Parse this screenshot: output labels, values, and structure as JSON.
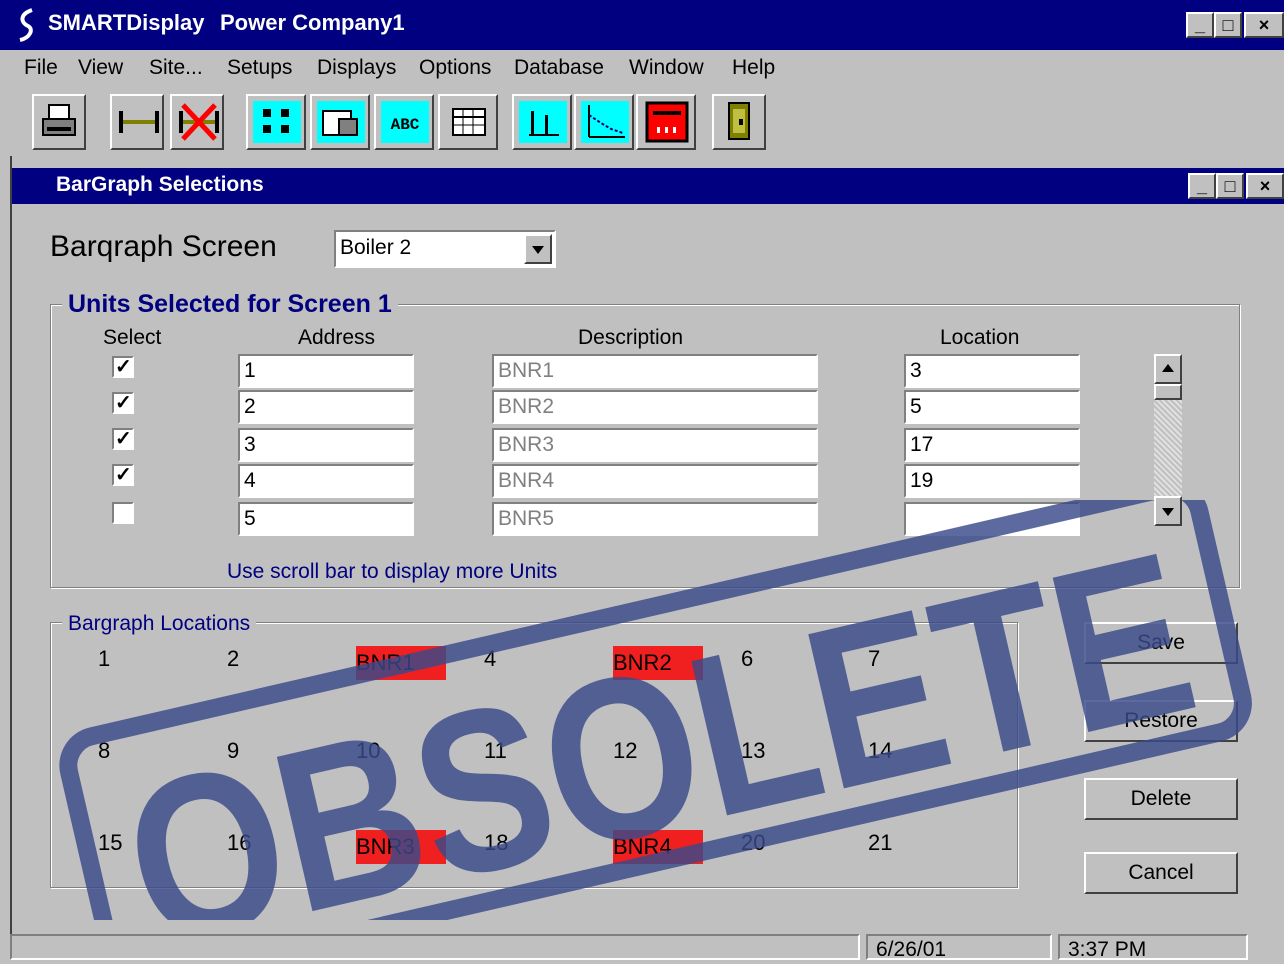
{
  "app": {
    "name": "SMARTDisplay",
    "document": "Power Company1"
  },
  "window_buttons": {
    "minimize": "_",
    "maximize": "□",
    "close": "×"
  },
  "menu": [
    "File",
    "View",
    "Site...",
    "Setups",
    "Displays",
    "Options",
    "Database",
    "Window",
    "Help"
  ],
  "toolbar": [
    "printer-icon",
    "connect-icon",
    "disconnect-icon",
    "list-display-icon",
    "table-display-icon",
    "text-display-icon",
    "grid-display-icon",
    "bargraph-icon",
    "trend-icon",
    "meter-icon",
    "exit-door-icon"
  ],
  "toolbar_text": {
    "abc": "ABC"
  },
  "dialog": {
    "title": "BarGraph Selections",
    "screen_label": "Barqraph Screen",
    "screen_value": "Boiler 2",
    "units_group": {
      "title": "Units Selected for Screen 1",
      "headers": {
        "select": "Select",
        "address": "Address",
        "description": "Description",
        "location": "Location"
      },
      "rows": [
        {
          "checked": true,
          "address": "1",
          "description": "BNR1",
          "location": "3"
        },
        {
          "checked": true,
          "address": "2",
          "description": "BNR2",
          "location": "5"
        },
        {
          "checked": true,
          "address": "3",
          "description": "BNR3",
          "location": "17"
        },
        {
          "checked": true,
          "address": "4",
          "description": "BNR4",
          "location": "19"
        },
        {
          "checked": false,
          "address": "5",
          "description": "BNR5",
          "location": ""
        }
      ],
      "hint": "Use scroll bar to display more Units"
    },
    "locations_group": {
      "title": "Bargraph Locations",
      "cells": [
        [
          "1",
          "2",
          "BNR1",
          "4",
          "BNR2",
          "6",
          "7"
        ],
        [
          "8",
          "9",
          "10",
          "11",
          "12",
          "13",
          "14"
        ],
        [
          "15",
          "16",
          "BNR3",
          "18",
          "BNR4",
          "20",
          "21"
        ]
      ],
      "highlighted": [
        "BNR1",
        "BNR2",
        "BNR3",
        "BNR4"
      ]
    },
    "buttons": {
      "save": "Save",
      "restore": "Restore",
      "delete": "Delete",
      "cancel": "Cancel"
    }
  },
  "status": {
    "date": "6/26/01",
    "time": "3:37 PM"
  },
  "stamp_text": "OBSOLETE",
  "colors": {
    "titlebar": "#000080",
    "highlight": "#f02020",
    "accent_text": "#000080",
    "stamp": "#3a4a8a"
  }
}
